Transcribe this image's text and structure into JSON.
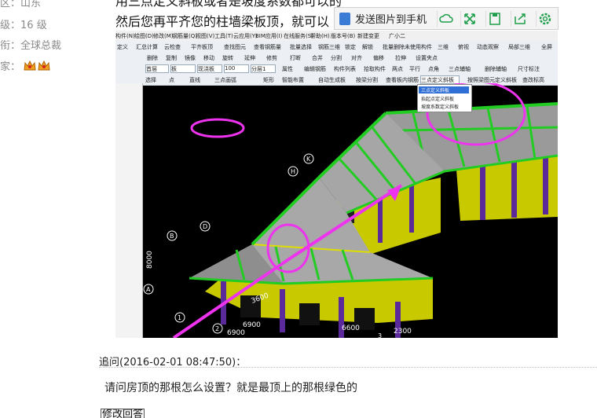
{
  "user_info": {
    "region_label": "区：",
    "region_value": "山东",
    "level_label": "级：",
    "level_value": "16 级",
    "rank_label": "衔：",
    "rank_value": "全球总裁",
    "expert_label": "家："
  },
  "post": {
    "line_top_cut": "用三点定义斜板或者是坡度系数都可以的",
    "line_main": "然后您再平齐您的柱墙梁板顶，就可以"
  },
  "float_toolbar": {
    "send_label": "发送图片到手机",
    "icons": [
      "cloud-icon",
      "expand-icon",
      "save-icon",
      "share-icon",
      "settings-icon"
    ]
  },
  "software": {
    "menu": [
      "构件(N)",
      "绘图(D)",
      "修改(M)",
      "钢筋量(Q)",
      "视图(V)",
      "工具(T)",
      "云应用(Y)",
      "BIM应用(I)",
      "在线服务(S)",
      "帮助(H)",
      "版本号(B)",
      "新建变更",
      "广小二"
    ],
    "toolbar1": [
      "定义",
      "汇总计算",
      "云检查",
      "平齐板顶",
      "查找图元",
      "查看钢筋量",
      "批量选择",
      "钢筋三维",
      "锁定",
      "解锁",
      "批量删除未使用构件",
      "三维",
      "俯视",
      "动态观察",
      "局部三维",
      "全屏"
    ],
    "toolbar2": [
      "删除",
      "复制",
      "镜像",
      "移动",
      "旋转",
      "延伸",
      "修剪",
      "打断",
      "合并",
      "分割",
      "对齐",
      "偏移",
      "拉伸",
      "设置夹点"
    ],
    "toolbar3": [
      "首层",
      "板",
      "现浇板",
      "100",
      "分层1",
      "属性",
      "编辑钢筋",
      "构件列表",
      "拾取构件",
      "两点",
      "平行",
      "点角",
      "三点辅轴",
      "删除辅轴",
      "尺寸标注"
    ],
    "toolbar4": [
      "选择",
      "点",
      "直线",
      "三点画弧",
      "矩形",
      "智能布置",
      "自动生成板",
      "按梁分割",
      "查看板内钢筋",
      "三点定义斜板",
      "按照梁图元定义斜板",
      "查改标高"
    ],
    "dropdown": [
      "三点定义斜板",
      "抬起点定义斜板",
      "坡度系数定义斜板"
    ]
  },
  "drawing": {
    "dims": [
      "6900",
      "6900",
      "6600",
      "2300",
      "8000",
      "3600"
    ],
    "axes": [
      "A",
      "B",
      "D",
      "H",
      "K",
      "1",
      "2",
      "3"
    ]
  },
  "question": {
    "header": "追问(2016-02-01 08:47:50)：",
    "body": "请问房顶的那根怎么设置？就是最顶上的那根绿色的",
    "edit_button": "修改回答"
  }
}
